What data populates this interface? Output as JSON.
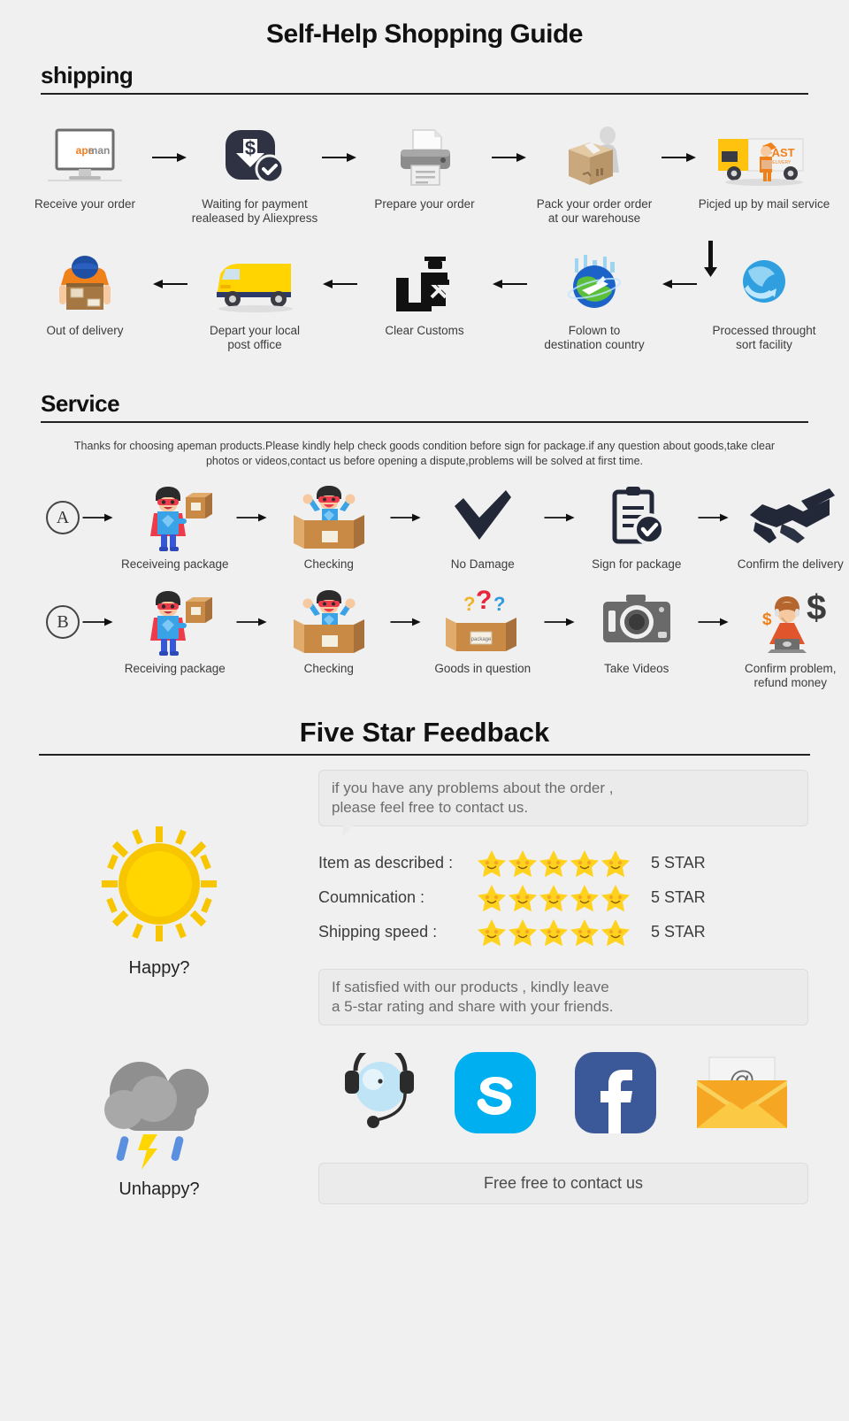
{
  "title": "Self-Help Shopping Guide",
  "shipping": {
    "heading": "shipping",
    "row1": [
      {
        "icon": "monitor-apeman-icon",
        "caption": "Receive your order",
        "logo": "apeman"
      },
      {
        "icon": "payment-dollar-check-icon",
        "caption": "Waiting for payment\nrealeased by Aliexpress"
      },
      {
        "icon": "printer-icon",
        "caption": "Prepare your order"
      },
      {
        "icon": "worker-packing-box-icon",
        "caption": "Pack your order order\nat our warehouse"
      },
      {
        "icon": "fast-delivery-truck-icon",
        "caption": "Picjed up by mail service",
        "truck_label": "FAST",
        "truck_sublabel": "DELIVERY"
      }
    ],
    "row2": [
      {
        "icon": "courier-carrying-box-icon",
        "caption": "Out of delivery"
      },
      {
        "icon": "yellow-van-icon",
        "caption": "Depart your local\npost office"
      },
      {
        "icon": "customs-officer-icon",
        "caption": "Clear Customs"
      },
      {
        "icon": "globe-airplane-icon",
        "caption": "Folown to\ndestination country"
      },
      {
        "icon": "globe-sort-facility-icon",
        "caption": "Processed throught\nsort facility"
      }
    ]
  },
  "service": {
    "heading": "Service",
    "note": "Thanks for choosing apeman products.Please kindly help check goods condition before sign for package.if any question about goods,take clear photos or videos,contact us before opening a dispute,problems will be solved at first time.",
    "row_a": {
      "badge": "A",
      "steps": [
        {
          "icon": "hero-with-package-icon",
          "caption": "Receiveing package"
        },
        {
          "icon": "hero-in-open-box-icon",
          "caption": "Checking"
        },
        {
          "icon": "checkmark-icon",
          "caption": "No Damage"
        },
        {
          "icon": "clipboard-check-icon",
          "caption": "Sign for package"
        },
        {
          "icon": "handshake-icon",
          "caption": "Confirm the delivery"
        }
      ]
    },
    "row_b": {
      "badge": "B",
      "steps": [
        {
          "icon": "hero-with-package-icon",
          "caption": "Receiving package"
        },
        {
          "icon": "hero-in-open-box-icon",
          "caption": "Checking"
        },
        {
          "icon": "box-question-marks-icon",
          "caption": "Goods in question",
          "box_label": "package"
        },
        {
          "icon": "camera-icon",
          "caption": "Take Videos"
        },
        {
          "icon": "support-agent-dollar-icon",
          "caption": "Confirm problem,\nrefund money"
        }
      ]
    }
  },
  "feedback": {
    "heading": "Five Star Feedback",
    "bubble_top": "if you have any problems about the order ,\nplease feel free to contact us.",
    "bubble_bottom": "If satisfied with our products ,  kindly leave\na 5-star rating and share with your friends.",
    "happy_label": "Happy?",
    "unhappy_label": "Unhappy?",
    "sun_icon": "sun-icon",
    "cloud_icon": "rain-cloud-icon",
    "ratings": [
      {
        "label": "Item as described :",
        "stars": 5,
        "value": "5 STAR"
      },
      {
        "label": "Coumnication :",
        "stars": 5,
        "value": "5 STAR"
      },
      {
        "label": "Shipping speed :",
        "stars": 5,
        "value": "5 STAR"
      }
    ],
    "contact_icons": [
      {
        "name": "headset-support-icon"
      },
      {
        "name": "skype-icon"
      },
      {
        "name": "facebook-icon"
      },
      {
        "name": "email-envelope-icon",
        "glyph": "@"
      }
    ],
    "contact_button": "Free free to contact us"
  },
  "colors": {
    "bg": "#f0f0f0",
    "text": "#3c3c3c",
    "star": "#ffd21e",
    "star_dark": "#f5b800",
    "orange": "#f59c1a",
    "yellow": "#ffd400",
    "skype": "#00aff0",
    "facebook": "#3b5998",
    "dark": "#2d3142"
  }
}
